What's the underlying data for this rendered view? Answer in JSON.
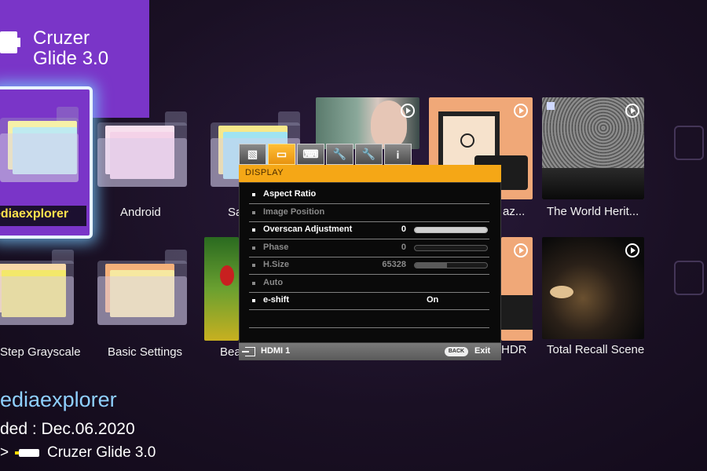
{
  "device": {
    "title_line1": "Cruzer",
    "title_line2": "Glide 3.0"
  },
  "tiles_row1": [
    {
      "label": "ediaexplorer"
    },
    {
      "label": "Android"
    },
    {
      "label": "Sa"
    },
    {
      "label": ""
    },
    {
      "label": "az..."
    },
    {
      "label": "The World Herit..."
    }
  ],
  "tiles_row2": [
    {
      "label": "Step Grayscale"
    },
    {
      "label": "Basic Settings"
    },
    {
      "label": "Bea"
    },
    {
      "label": "HDR"
    },
    {
      "label": "Total Recall Scene"
    }
  ],
  "osd": {
    "tabs": [
      {
        "icon": "picture-icon",
        "glyph": "▧"
      },
      {
        "icon": "display-icon",
        "glyph": "▭"
      },
      {
        "icon": "keyboard-icon",
        "glyph": "⌨"
      },
      {
        "icon": "wrench-icon",
        "glyph": "🔧"
      },
      {
        "icon": "wrench2-icon",
        "glyph": "🔧"
      },
      {
        "icon": "info-icon",
        "glyph": "i"
      }
    ],
    "active_tab": 1,
    "header": "DISPLAY",
    "rows": [
      {
        "label": "Aspect Ratio",
        "value": "",
        "enabled": true,
        "bar": null
      },
      {
        "label": "Image Position",
        "value": "",
        "enabled": false,
        "bar": null
      },
      {
        "label": "Overscan Adjustment",
        "value": "0",
        "enabled": true,
        "bar": 1.0
      },
      {
        "label": "Phase",
        "value": "0",
        "enabled": false,
        "bar": 0.0
      },
      {
        "label": "H.Size",
        "value": "65328",
        "enabled": false,
        "bar": 0.45
      },
      {
        "label": "Auto",
        "value": "",
        "enabled": false,
        "bar": null
      },
      {
        "label": "e-shift",
        "value": "On",
        "enabled": true,
        "bar": null
      },
      {
        "label": "",
        "value": "",
        "enabled": true,
        "bar": null
      }
    ],
    "footer": {
      "input": "HDMI 1",
      "back": "BACK",
      "exit": "Exit"
    }
  },
  "info": {
    "name": "ediaexplorer",
    "date": "ded : Dec.06.2020",
    "path_prefix": ">",
    "path": "Cruzer Glide 3.0"
  },
  "colors": {
    "accent": "#7a35c8",
    "osd_orange": "#f5a716",
    "focus_label": "#ffe24d"
  }
}
